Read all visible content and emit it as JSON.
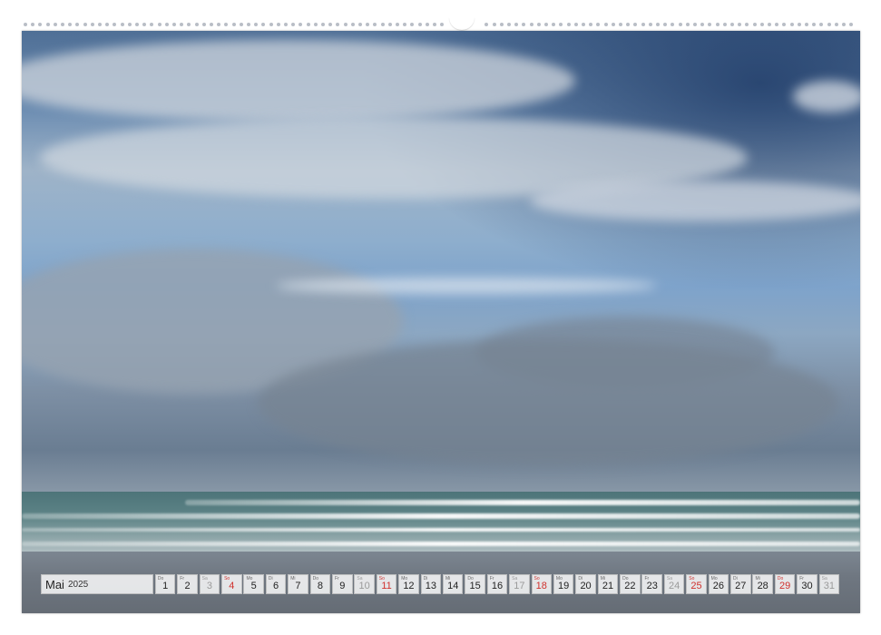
{
  "calendar": {
    "month": "Mai",
    "year": "2025",
    "days": [
      {
        "wd": "Do",
        "num": "1",
        "type": "weekday"
      },
      {
        "wd": "Fr",
        "num": "2",
        "type": "weekday"
      },
      {
        "wd": "Sa",
        "num": "3",
        "type": "sat"
      },
      {
        "wd": "So",
        "num": "4",
        "type": "sun"
      },
      {
        "wd": "Mo",
        "num": "5",
        "type": "weekday"
      },
      {
        "wd": "Di",
        "num": "6",
        "type": "weekday"
      },
      {
        "wd": "Mi",
        "num": "7",
        "type": "weekday"
      },
      {
        "wd": "Do",
        "num": "8",
        "type": "weekday"
      },
      {
        "wd": "Fr",
        "num": "9",
        "type": "weekday"
      },
      {
        "wd": "Sa",
        "num": "10",
        "type": "sat"
      },
      {
        "wd": "So",
        "num": "11",
        "type": "sun"
      },
      {
        "wd": "Mo",
        "num": "12",
        "type": "weekday"
      },
      {
        "wd": "Di",
        "num": "13",
        "type": "weekday"
      },
      {
        "wd": "Mi",
        "num": "14",
        "type": "weekday"
      },
      {
        "wd": "Do",
        "num": "15",
        "type": "weekday"
      },
      {
        "wd": "Fr",
        "num": "16",
        "type": "weekday"
      },
      {
        "wd": "Sa",
        "num": "17",
        "type": "sat"
      },
      {
        "wd": "So",
        "num": "18",
        "type": "sun"
      },
      {
        "wd": "Mo",
        "num": "19",
        "type": "weekday"
      },
      {
        "wd": "Di",
        "num": "20",
        "type": "weekday"
      },
      {
        "wd": "Mi",
        "num": "21",
        "type": "weekday"
      },
      {
        "wd": "Do",
        "num": "22",
        "type": "weekday"
      },
      {
        "wd": "Fr",
        "num": "23",
        "type": "weekday"
      },
      {
        "wd": "Sa",
        "num": "24",
        "type": "sat"
      },
      {
        "wd": "So",
        "num": "25",
        "type": "sun"
      },
      {
        "wd": "Mo",
        "num": "26",
        "type": "weekday"
      },
      {
        "wd": "Di",
        "num": "27",
        "type": "weekday"
      },
      {
        "wd": "Mi",
        "num": "28",
        "type": "weekday"
      },
      {
        "wd": "Do",
        "num": "29",
        "type": "sun"
      },
      {
        "wd": "Fr",
        "num": "30",
        "type": "weekday"
      },
      {
        "wd": "Sa",
        "num": "31",
        "type": "sat"
      }
    ]
  },
  "colors": {
    "holiday_red": "#d0312d",
    "saturday_gray": "#9a9a9a"
  }
}
